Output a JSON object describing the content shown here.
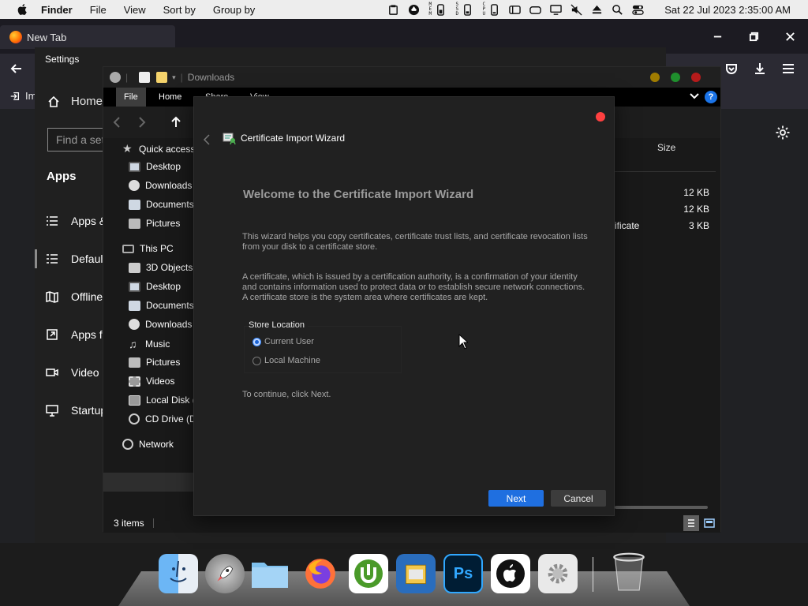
{
  "menubar": {
    "app_name": "Finder",
    "menus": [
      "File",
      "View",
      "Sort by",
      "Group by"
    ],
    "status_minis": [
      {
        "label": "M\nE\nM"
      },
      {
        "label": "S\nS\nD"
      },
      {
        "label": "C\nP\nU"
      }
    ],
    "clock": "Sat 22 Jul 2023  2:35:00 AM"
  },
  "browser": {
    "tab_title": "New Tab",
    "import_label": "Im"
  },
  "settings": {
    "window_title": "Settings",
    "home_label": "Home",
    "search_placeholder": "Find a setting",
    "apps_heading": "Apps",
    "nav": [
      {
        "label": "Apps & features",
        "icon": "list-icon"
      },
      {
        "label": "Default apps",
        "icon": "default-apps-icon"
      },
      {
        "label": "Offline maps",
        "icon": "map-icon"
      },
      {
        "label": "Apps for websites",
        "icon": "link-icon"
      },
      {
        "label": "Video playback",
        "icon": "video-icon"
      },
      {
        "label": "Startup",
        "icon": "startup-icon"
      }
    ]
  },
  "explorer": {
    "title": "Downloads",
    "ribbon_tabs": [
      "File",
      "Home",
      "Share",
      "View"
    ],
    "quick_access_label": "Quick access",
    "quick_access": [
      "Desktop",
      "Downloads",
      "Documents",
      "Pictures"
    ],
    "this_pc_label": "This PC",
    "this_pc": [
      "3D Objects",
      "Desktop",
      "Documents",
      "Downloads",
      "Music",
      "Pictures",
      "Videos",
      "Local Disk (C:)",
      "CD Drive (D:)"
    ],
    "network_label": "Network",
    "column_size": "Size",
    "files": [
      {
        "name": "",
        "size": "12 KB"
      },
      {
        "name": "",
        "size": "12 KB"
      },
      {
        "name": "ificate",
        "size": "3 KB"
      }
    ],
    "status_count": "3 items"
  },
  "wizard": {
    "caption": "Certificate Import Wizard",
    "headline": "Welcome to the Certificate Import Wizard",
    "para1": "This wizard helps you copy certificates, certificate trust lists, and certificate revocation lists from your disk to a certificate store.",
    "para2": "A certificate, which is issued by a certification authority, is a confirmation of your identity and contains information used to protect data or to establish secure network connections. A certificate store is the system area where certificates are kept.",
    "store_label": "Store Location",
    "options": [
      {
        "label": "Current User",
        "selected": true
      },
      {
        "label": "Local Machine",
        "selected": false
      }
    ],
    "continue_text": "To continue, click Next.",
    "next_label": "Next",
    "cancel_label": "Cancel"
  },
  "dock": {
    "apps": [
      "finder-icon",
      "launchpad-icon",
      "folder-icon",
      "firefox-icon",
      "utorrent-icon",
      "archive-utility-icon",
      "photoshop-icon",
      "apple-icon",
      "system-preferences-icon",
      "trash-icon"
    ]
  },
  "colors": {
    "accent": "#1f6fe0",
    "close_red": "#ff4040"
  }
}
